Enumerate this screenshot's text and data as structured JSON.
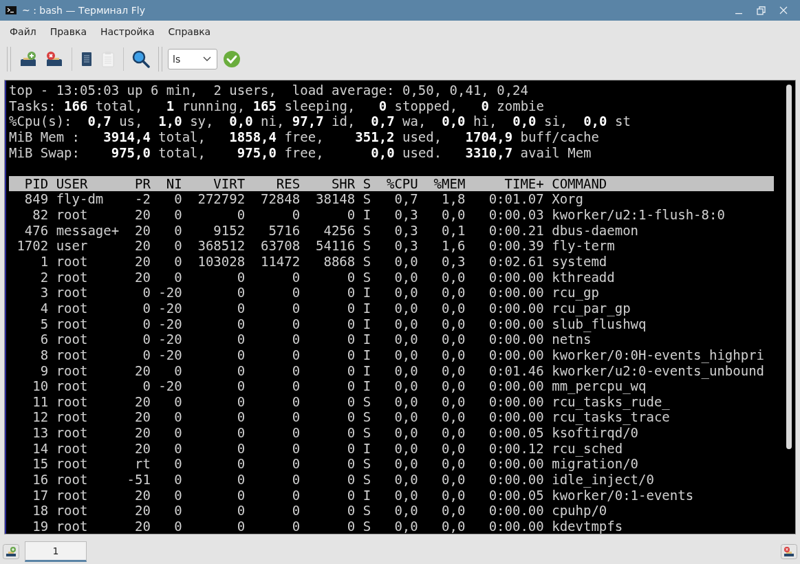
{
  "window": {
    "title": "~ : bash — Терминал Fly"
  },
  "menu": [
    "Файл",
    "Правка",
    "Настройка",
    "Справка"
  ],
  "toolbar": {
    "command_combo": {
      "value": "ls"
    }
  },
  "terminal": {
    "summary_lines": [
      "top - 13:05:03 up 6 min,  2 users,  load average: 0,50, 0,41, 0,24",
      "Tasks: **166** total,   **1** running, **165** sleeping,   **0** stopped,   **0** zombie",
      "%Cpu(s):  **0,7** us,  **1,0** sy,  **0,0** ni, **97,7** id,  **0,7** wa,  **0,0** hi,  **0,0** si,  **0,0** st",
      "MiB Mem :   **3914,4** total,   **1858,4** free,    **351,2** used,   **1704,9** buff/cache",
      "MiB Swap:    **975,0** total,    **975,0** free,      **0,0** used.   **3310,7** avail Mem"
    ],
    "table": {
      "columns": [
        "PID",
        "USER",
        "PR",
        "NI",
        "VIRT",
        "RES",
        "SHR",
        "S",
        "%CPU",
        "%MEM",
        "TIME+",
        "COMMAND"
      ],
      "rows": [
        [
          "849",
          "fly-dm",
          "-2",
          "0",
          "272792",
          "72848",
          "38148",
          "S",
          "0,7",
          "1,8",
          "0:01.07",
          "Xorg"
        ],
        [
          "82",
          "root",
          "20",
          "0",
          "0",
          "0",
          "0",
          "I",
          "0,3",
          "0,0",
          "0:00.03",
          "kworker/u2:1-flush-8:0"
        ],
        [
          "476",
          "message+",
          "20",
          "0",
          "9152",
          "5716",
          "4256",
          "S",
          "0,3",
          "0,1",
          "0:00.21",
          "dbus-daemon"
        ],
        [
          "1702",
          "user",
          "20",
          "0",
          "368512",
          "63708",
          "54116",
          "S",
          "0,3",
          "1,6",
          "0:00.39",
          "fly-term"
        ],
        [
          "1",
          "root",
          "20",
          "0",
          "103028",
          "11472",
          "8868",
          "S",
          "0,0",
          "0,3",
          "0:02.61",
          "systemd"
        ],
        [
          "2",
          "root",
          "20",
          "0",
          "0",
          "0",
          "0",
          "S",
          "0,0",
          "0,0",
          "0:00.00",
          "kthreadd"
        ],
        [
          "3",
          "root",
          "0",
          "-20",
          "0",
          "0",
          "0",
          "I",
          "0,0",
          "0,0",
          "0:00.00",
          "rcu_gp"
        ],
        [
          "4",
          "root",
          "0",
          "-20",
          "0",
          "0",
          "0",
          "I",
          "0,0",
          "0,0",
          "0:00.00",
          "rcu_par_gp"
        ],
        [
          "5",
          "root",
          "0",
          "-20",
          "0",
          "0",
          "0",
          "I",
          "0,0",
          "0,0",
          "0:00.00",
          "slub_flushwq"
        ],
        [
          "6",
          "root",
          "0",
          "-20",
          "0",
          "0",
          "0",
          "I",
          "0,0",
          "0,0",
          "0:00.00",
          "netns"
        ],
        [
          "8",
          "root",
          "0",
          "-20",
          "0",
          "0",
          "0",
          "I",
          "0,0",
          "0,0",
          "0:00.00",
          "kworker/0:0H-events_highpri"
        ],
        [
          "9",
          "root",
          "20",
          "0",
          "0",
          "0",
          "0",
          "I",
          "0,0",
          "0,0",
          "0:01.46",
          "kworker/u2:0-events_unbound"
        ],
        [
          "10",
          "root",
          "0",
          "-20",
          "0",
          "0",
          "0",
          "I",
          "0,0",
          "0,0",
          "0:00.00",
          "mm_percpu_wq"
        ],
        [
          "11",
          "root",
          "20",
          "0",
          "0",
          "0",
          "0",
          "S",
          "0,0",
          "0,0",
          "0:00.00",
          "rcu_tasks_rude_"
        ],
        [
          "12",
          "root",
          "20",
          "0",
          "0",
          "0",
          "0",
          "S",
          "0,0",
          "0,0",
          "0:00.00",
          "rcu_tasks_trace"
        ],
        [
          "13",
          "root",
          "20",
          "0",
          "0",
          "0",
          "0",
          "S",
          "0,0",
          "0,0",
          "0:00.05",
          "ksoftirqd/0"
        ],
        [
          "14",
          "root",
          "20",
          "0",
          "0",
          "0",
          "0",
          "I",
          "0,0",
          "0,0",
          "0:00.12",
          "rcu_sched"
        ],
        [
          "15",
          "root",
          "rt",
          "0",
          "0",
          "0",
          "0",
          "S",
          "0,0",
          "0,0",
          "0:00.00",
          "migration/0"
        ],
        [
          "16",
          "root",
          "-51",
          "0",
          "0",
          "0",
          "0",
          "S",
          "0,0",
          "0,0",
          "0:00.00",
          "idle_inject/0"
        ],
        [
          "17",
          "root",
          "20",
          "0",
          "0",
          "0",
          "0",
          "I",
          "0,0",
          "0,0",
          "0:00.05",
          "kworker/0:1-events"
        ],
        [
          "18",
          "root",
          "20",
          "0",
          "0",
          "0",
          "0",
          "S",
          "0,0",
          "0,0",
          "0:00.00",
          "cpuhp/0"
        ],
        [
          "19",
          "root",
          "20",
          "0",
          "0",
          "0",
          "0",
          "S",
          "0,0",
          "0,0",
          "0:00.00",
          "kdevtmpfs"
        ]
      ]
    }
  },
  "tabs": [
    {
      "label": "1",
      "selected": true
    }
  ]
}
